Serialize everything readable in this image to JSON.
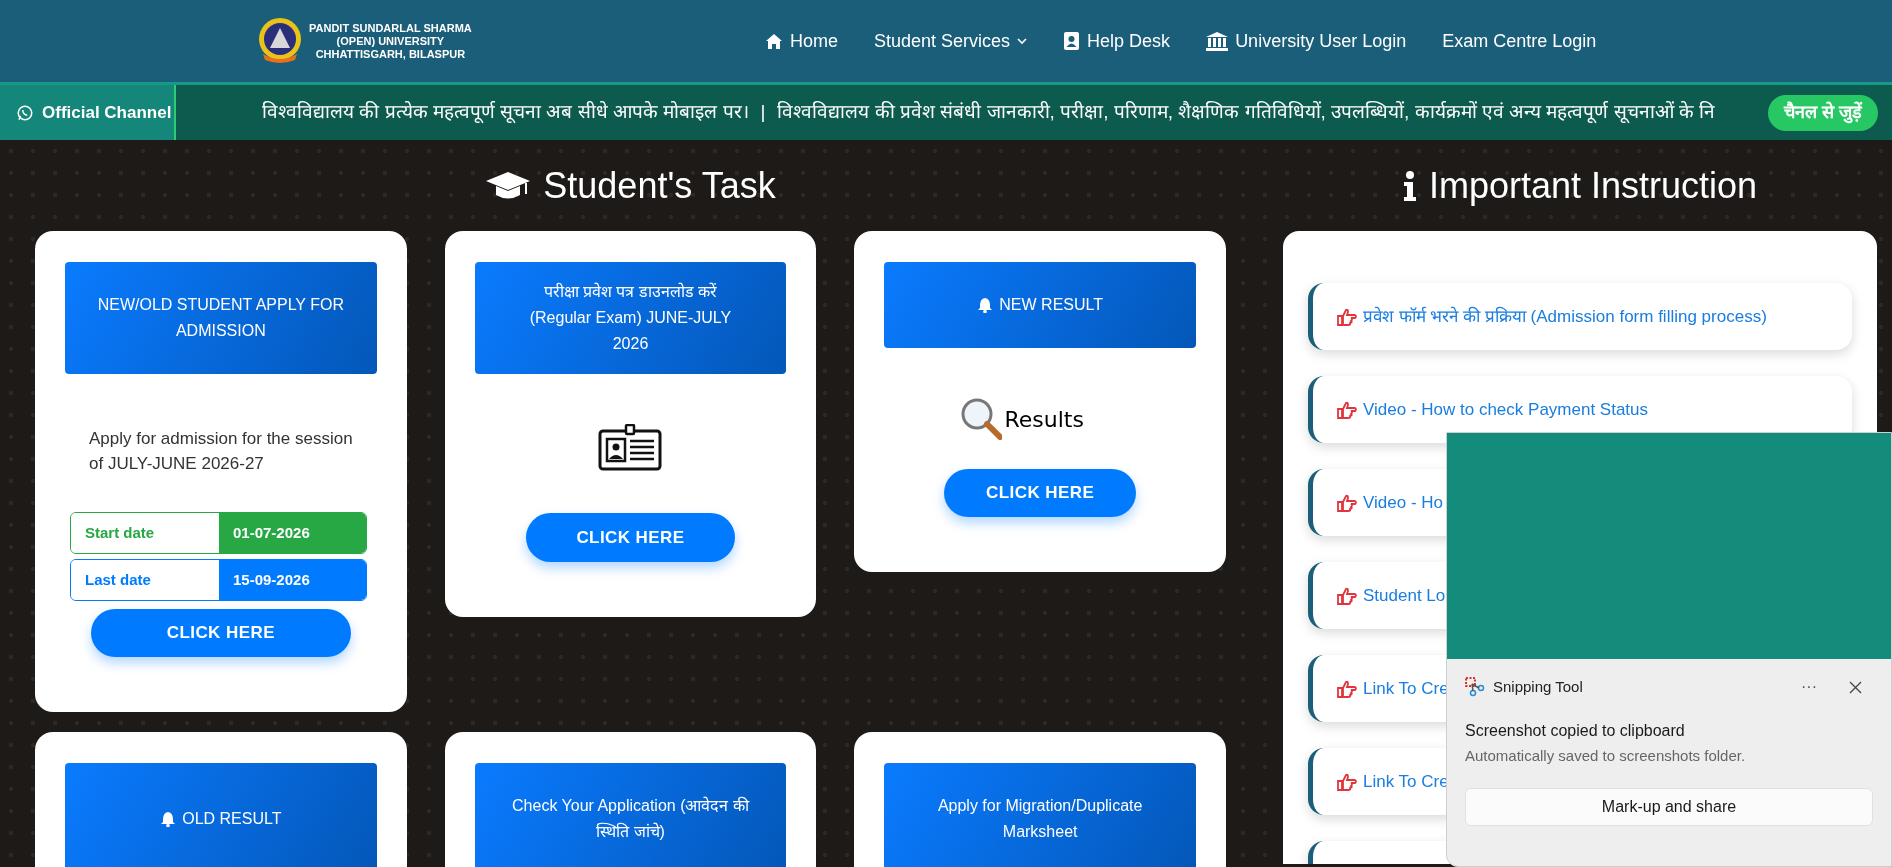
{
  "header": {
    "logo_lines": [
      "PANDIT SUNDARLAL SHARMA",
      "(OPEN) UNIVERSITY",
      "CHHATTISGARH, BILASPUR"
    ],
    "nav": [
      {
        "label": "Home"
      },
      {
        "label": "Student Services"
      },
      {
        "label": "Help Desk"
      },
      {
        "label": "University User Login"
      },
      {
        "label": "Exam Centre Login"
      }
    ]
  },
  "ticker": {
    "label": "Official Channel",
    "messages": [
      "विश्वविद्यालय की प्रत्येक महत्वपूर्ण सूचना अब सीधे आपके मोबाइल पर।",
      "विश्वविद्यालय की प्रवेश संबंधी जानकारी, परीक्षा, परिणाम, शैक्षणिक गतिविधियों, उपलब्धियों, कार्यक्रमों एवं अन्य महत्वपूर्ण सूचनाओं के नि"
    ],
    "separator": "|",
    "button": "चैनल से जुड़ें"
  },
  "student_tasks": {
    "title": "Student's Task",
    "cards": [
      {
        "kind": "admission",
        "heading": "NEW/OLD STUDENT APPLY FOR ADMISSION",
        "description": "Apply for admission for the session of JULY-JUNE 2026-27",
        "dates": [
          {
            "label": "Start date",
            "value": "01-07-2026",
            "color": "#28a745"
          },
          {
            "label": "Last date",
            "value": "15-09-2026",
            "color": "#007bff"
          }
        ],
        "button": "CLICK HERE"
      },
      {
        "kind": "admit_card",
        "heading": "परीक्षा प्रवेश पत्र डाउनलोड करें (Regular Exam) JUNE-JULY 2026",
        "button": "CLICK HERE"
      },
      {
        "kind": "result",
        "heading": "NEW RESULT",
        "image_text": "Results",
        "button": "CLICK HERE"
      },
      {
        "kind": "header_only",
        "heading": "OLD RESULT"
      },
      {
        "kind": "header_only",
        "heading": "Check Your Application (आवेदन की स्थिति जांचे)"
      },
      {
        "kind": "header_only",
        "heading": "Apply for Migration/Duplicate Marksheet"
      }
    ]
  },
  "instructions": {
    "title": "Important Instruction",
    "items": [
      {
        "label": "प्रवेश फॉर्म भरने की प्रक्रिया (Admission form filling process)"
      },
      {
        "label": "Video - How to check Payment Status"
      },
      {
        "label": "Video - Ho"
      },
      {
        "label": "Student Lo"
      },
      {
        "label": "Link To Cre"
      },
      {
        "label": "Link To Cre"
      }
    ]
  },
  "toast": {
    "app": "Snipping Tool",
    "more": "···",
    "title": "Screenshot copied to clipboard",
    "message": "Automatically saved to screenshots folder.",
    "button": "Mark-up and share"
  }
}
